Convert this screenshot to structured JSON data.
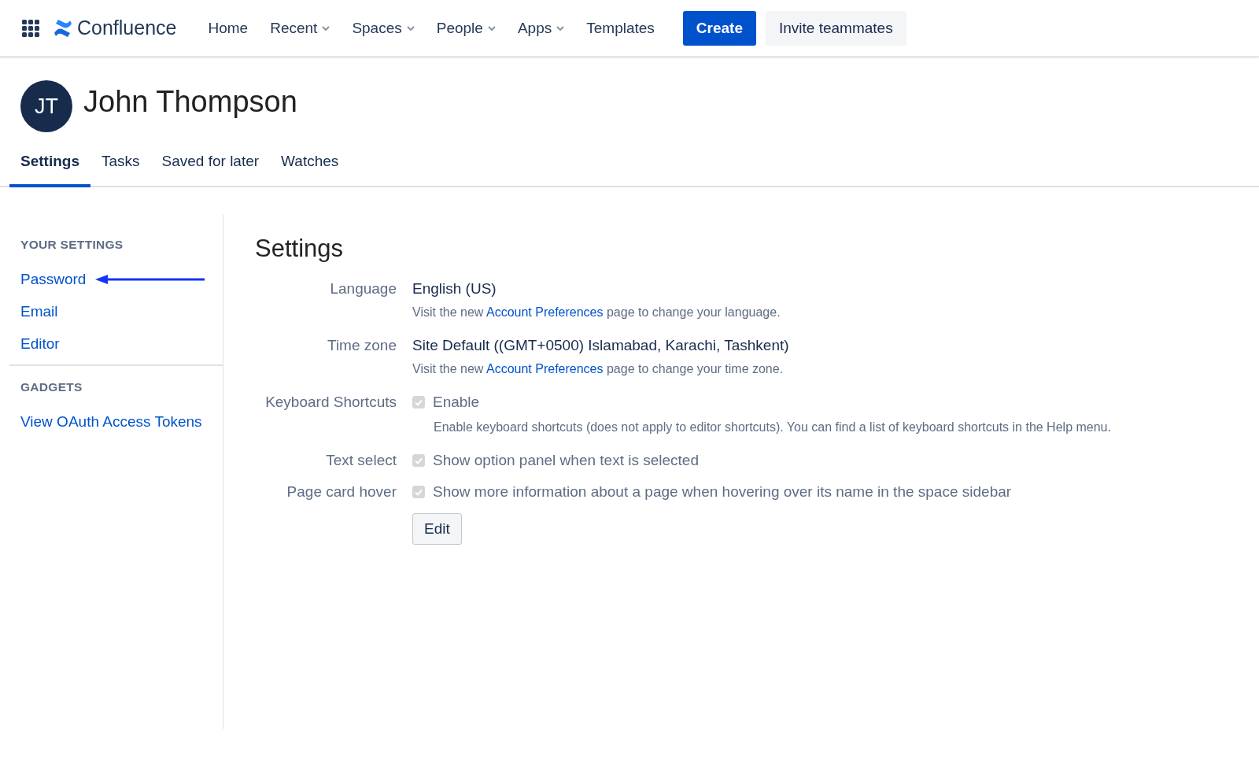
{
  "nav": {
    "logo": "Confluence",
    "items": [
      {
        "label": "Home",
        "dropdown": false
      },
      {
        "label": "Recent",
        "dropdown": true
      },
      {
        "label": "Spaces",
        "dropdown": true
      },
      {
        "label": "People",
        "dropdown": true
      },
      {
        "label": "Apps",
        "dropdown": true
      },
      {
        "label": "Templates",
        "dropdown": false
      }
    ],
    "create_button": "Create",
    "invite_button": "Invite teammates"
  },
  "profile": {
    "initials": "JT",
    "name": "John Thompson"
  },
  "tabs": [
    {
      "label": "Settings",
      "selected": true
    },
    {
      "label": "Tasks",
      "selected": false
    },
    {
      "label": "Saved for later",
      "selected": false
    },
    {
      "label": "Watches",
      "selected": false
    }
  ],
  "sidebar": {
    "sections": [
      {
        "heading": "YOUR SETTINGS",
        "items": [
          {
            "label": "Password",
            "annotated": true
          },
          {
            "label": "Email",
            "annotated": false
          },
          {
            "label": "Editor",
            "annotated": false
          }
        ]
      },
      {
        "heading": "GADGETS",
        "items": [
          {
            "label": "View OAuth Access Tokens",
            "annotated": false
          }
        ]
      }
    ]
  },
  "settings": {
    "title": "Settings",
    "rows": [
      {
        "kind": "text",
        "label": "Language",
        "value": "English (US)",
        "note": {
          "before": "Visit the new",
          "link": "Account Preferences",
          "after": "page to change your language."
        }
      },
      {
        "kind": "text",
        "label": "Time zone",
        "value": "Site Default ((GMT+0500) Islamabad, Karachi, Tashkent)",
        "note": {
          "before": "Visit the new",
          "link": "Account Preferences",
          "after": "page to change your time zone."
        }
      },
      {
        "kind": "checkbox",
        "label": "Keyboard Shortcuts",
        "value": "Enable",
        "checked": true,
        "disabled": true,
        "help": "Enable keyboard shortcuts (does not apply to editor shortcuts). You can find a list of keyboard shortcuts in the Help menu."
      },
      {
        "kind": "checkbox",
        "label": "Text select",
        "value": "Show option panel when text is selected",
        "checked": true,
        "disabled": true
      },
      {
        "kind": "checkbox",
        "label": "Page card hover",
        "value": "Show more information about a page when hovering over its name in the space sidebar",
        "checked": true,
        "disabled": true
      }
    ],
    "edit_button": "Edit"
  }
}
